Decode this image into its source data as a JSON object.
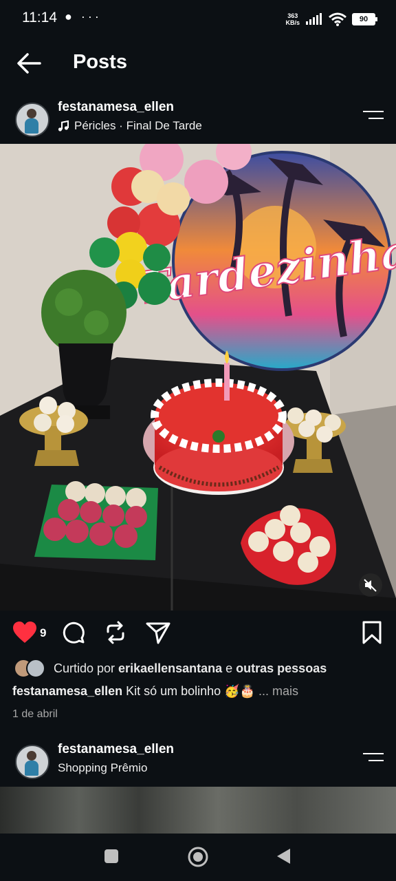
{
  "status_bar": {
    "time": "11:14",
    "left_icons": "● ···",
    "net_speed_value": "363",
    "net_speed_unit": "KB/s",
    "battery": "90"
  },
  "header": {
    "title": "Posts"
  },
  "post": {
    "username": "festanamesa_ellen",
    "music_label": "Péricles · Final De Tarde",
    "image_sign_text": "Tardezinha",
    "likes": "9",
    "liked_by_prefix": "Curtido por",
    "liked_by_user": "erikaellensantana",
    "liked_by_and": "e",
    "liked_by_others": "outras pessoas",
    "caption_user": "festanamesa_ellen",
    "caption_text": "Kit só um bolinho 🥳🎂",
    "caption_more": "... mais",
    "date": "1 de abril"
  },
  "next_post": {
    "username": "festanamesa_ellen",
    "location": "Shopping Prêmio"
  },
  "colors": {
    "background": "#0c1014",
    "like_red": "#ff3040",
    "secondary_text": "#a8a8a8"
  }
}
